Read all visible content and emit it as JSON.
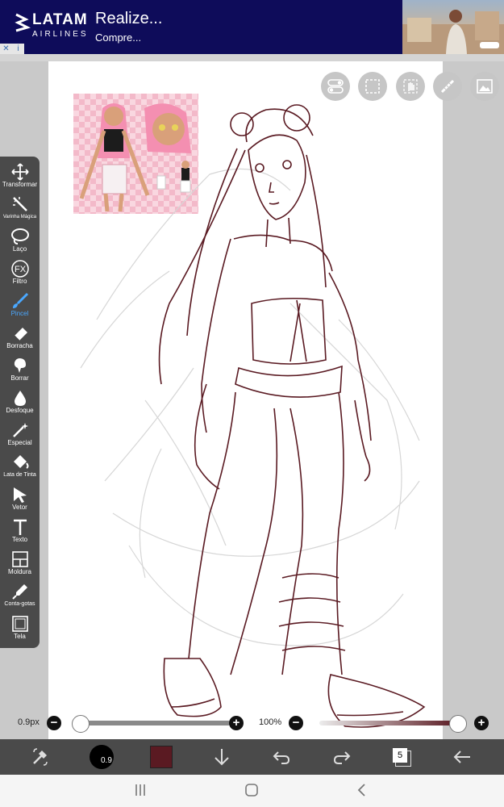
{
  "ad": {
    "brand": "LATAM",
    "sub": "AIRLINES",
    "title": "Realize...",
    "body": "Compre...",
    "close": "✕",
    "info": "i"
  },
  "colors": {
    "ad_bg": "#0e0c5a",
    "toolbar_bg": "#4a4a4a",
    "active_tool": "#4aa8ff",
    "brush_color": "#5a1a22",
    "canvas": "#ffffff"
  },
  "top_icons": [
    {
      "name": "toggle-icon"
    },
    {
      "name": "selection-icon"
    },
    {
      "name": "hand-icon"
    },
    {
      "name": "ruler-icon"
    },
    {
      "name": "image-icon"
    }
  ],
  "tools": [
    {
      "id": "transform",
      "label": "Transformar",
      "icon": "move-icon"
    },
    {
      "id": "magic-wand",
      "label": "Varinha Mágica",
      "icon": "magic-wand-icon"
    },
    {
      "id": "lasso",
      "label": "Laço",
      "icon": "lasso-icon"
    },
    {
      "id": "filter",
      "label": "Filtro",
      "icon": "fx-icon"
    },
    {
      "id": "brush",
      "label": "Pincel",
      "icon": "brush-icon",
      "active": true
    },
    {
      "id": "eraser",
      "label": "Borracha",
      "icon": "eraser-icon"
    },
    {
      "id": "smudge",
      "label": "Borrar",
      "icon": "smudge-icon"
    },
    {
      "id": "blur",
      "label": "Desfoque",
      "icon": "drop-icon"
    },
    {
      "id": "special",
      "label": "Especial",
      "icon": "sparkle-icon"
    },
    {
      "id": "bucket",
      "label": "Lata de Tinta",
      "icon": "bucket-icon"
    },
    {
      "id": "vector",
      "label": "Vetor",
      "icon": "cursor-icon"
    },
    {
      "id": "text",
      "label": "Texto",
      "icon": "text-icon"
    },
    {
      "id": "frame",
      "label": "Moldura",
      "icon": "frame-icon"
    },
    {
      "id": "eyedropper",
      "label": "Conta-gotas",
      "icon": "eyedropper-icon"
    },
    {
      "id": "canvas",
      "label": "Tela",
      "icon": "canvas-icon"
    }
  ],
  "controls": {
    "size_label": "0.9px",
    "size_minus": "−",
    "size_plus": "+",
    "opacity_label": "100%",
    "opacity_minus": "−",
    "opacity_plus": "+"
  },
  "actions": {
    "brush_size_badge": "0.9",
    "layers_count": "5"
  }
}
